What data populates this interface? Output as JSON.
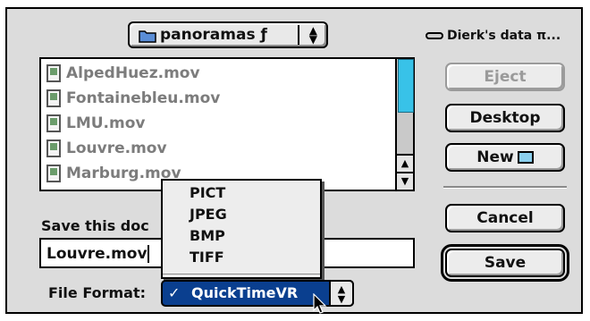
{
  "location_popup": {
    "label": "panoramas ƒ",
    "arrows": "▲▼"
  },
  "disk": {
    "label": "Dierk's data π..."
  },
  "files": [
    {
      "name": "AlpedHuez.mov"
    },
    {
      "name": "Fontainebleu.mov"
    },
    {
      "name": "LMU.mov"
    },
    {
      "name": "Louvre.mov"
    },
    {
      "name": "Marburg.mov"
    }
  ],
  "buttons": {
    "eject": "Eject",
    "desktop": "Desktop",
    "new": "New",
    "cancel": "Cancel",
    "save": "Save"
  },
  "save_prompt": "Save this doc",
  "filename_value": "Louvre.mov",
  "file_format": {
    "label": "File Format:",
    "selected": "QuickTimeVR",
    "check": "✓",
    "options": [
      "PICT",
      "JPEG",
      "BMP",
      "TIFF",
      "QuickTimeVR"
    ]
  },
  "scroll_arrows": {
    "up": "▲",
    "down": "▼"
  },
  "icons": {
    "folder": "folder-icon",
    "disk": "disk-icon",
    "file": "movie-file-icon",
    "new_folder": "new-folder-icon",
    "cursor": "arrow-cursor-icon"
  },
  "colors": {
    "highlight": "#0a3f8f",
    "scroll_thumb": "#38c2e8"
  }
}
